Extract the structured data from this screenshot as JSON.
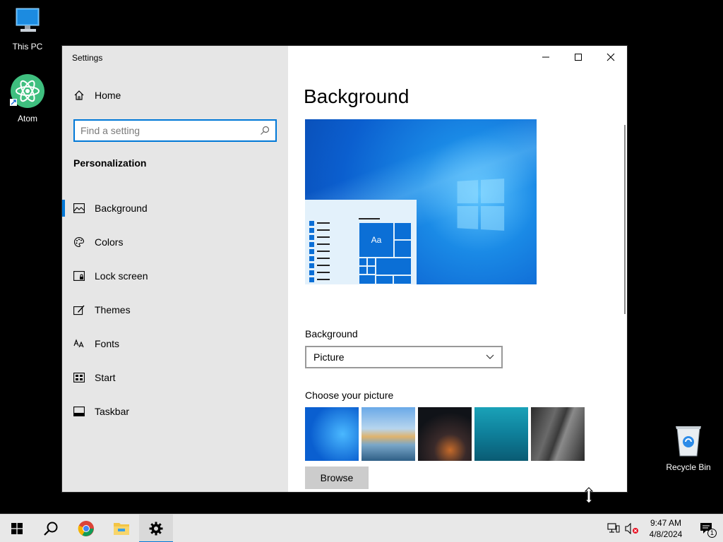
{
  "desktop": {
    "icons": [
      {
        "label": "This PC"
      },
      {
        "label": "Atom"
      },
      {
        "label": "Recycle Bin"
      }
    ]
  },
  "window": {
    "app_title": "Settings",
    "sidebar": {
      "home_label": "Home",
      "search_placeholder": "Find a setting",
      "section_title": "Personalization",
      "items": [
        {
          "label": "Background",
          "icon": "image-icon",
          "active": true
        },
        {
          "label": "Colors",
          "icon": "palette-icon"
        },
        {
          "label": "Lock screen",
          "icon": "lock-screen-icon"
        },
        {
          "label": "Themes",
          "icon": "themes-icon"
        },
        {
          "label": "Fonts",
          "icon": "fonts-icon"
        },
        {
          "label": "Start",
          "icon": "start-icon"
        },
        {
          "label": "Taskbar",
          "icon": "taskbar-icon"
        }
      ]
    },
    "main": {
      "page_title": "Background",
      "preview_tile_text": "Aa",
      "background_label": "Background",
      "background_value": "Picture",
      "choose_label": "Choose your picture",
      "browse_label": "Browse"
    }
  },
  "taskbar": {
    "time": "9:47 AM",
    "date": "4/8/2024",
    "notification_count": "1"
  },
  "colors": {
    "accent": "#0078d7",
    "sidebar_bg": "#e6e6e6",
    "taskbar_bg": "#e8e8e8"
  }
}
